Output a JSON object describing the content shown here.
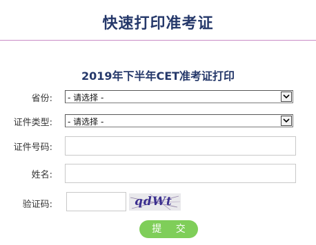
{
  "header": {
    "title": "快速打印准考证"
  },
  "form": {
    "title": "2019年下半年CET准考证打印",
    "province": {
      "label": "省份:",
      "value": "- 请选择 -"
    },
    "cert_type": {
      "label": "证件类型:",
      "value": "- 请选择 -"
    },
    "cert_number": {
      "label": "证件号码:",
      "value": ""
    },
    "name": {
      "label": "姓名:",
      "value": ""
    },
    "captcha": {
      "label": "验证码:",
      "value": "",
      "image_text": "qdWt"
    },
    "submit_label": "提 交"
  },
  "colors": {
    "title": "#25386a",
    "rule": "#c98ac6",
    "submit": "#7fce59"
  }
}
